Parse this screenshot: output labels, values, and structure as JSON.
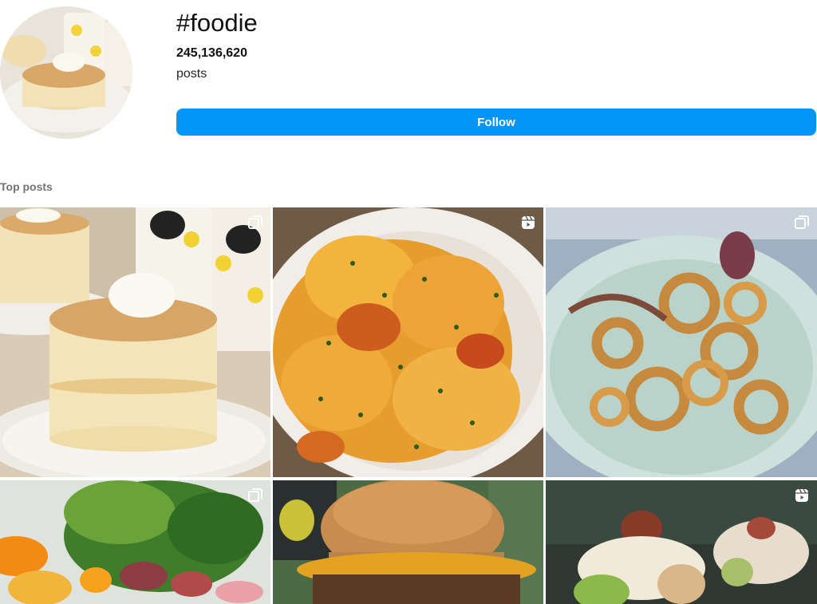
{
  "header": {
    "hashtag": "#foodie",
    "post_count": "245,136,620",
    "post_count_label": "posts",
    "follow_label": "Follow"
  },
  "section": {
    "label": "Top posts"
  },
  "posts": [
    {
      "subject": "souffle pancakes",
      "badge": "carousel-icon"
    },
    {
      "subject": "cheesy scalloped potatoes",
      "badge": "reel-icon"
    },
    {
      "subject": "fried calamari",
      "badge": "carousel-icon"
    },
    {
      "subject": "roasted vegetable salad",
      "badge": "carousel-icon"
    },
    {
      "subject": "cheeseburger",
      "badge": "none"
    },
    {
      "subject": "dessert platter",
      "badge": "reel-icon"
    }
  ],
  "colors": {
    "accent": "#0095f6",
    "muted_text": "#737373"
  }
}
